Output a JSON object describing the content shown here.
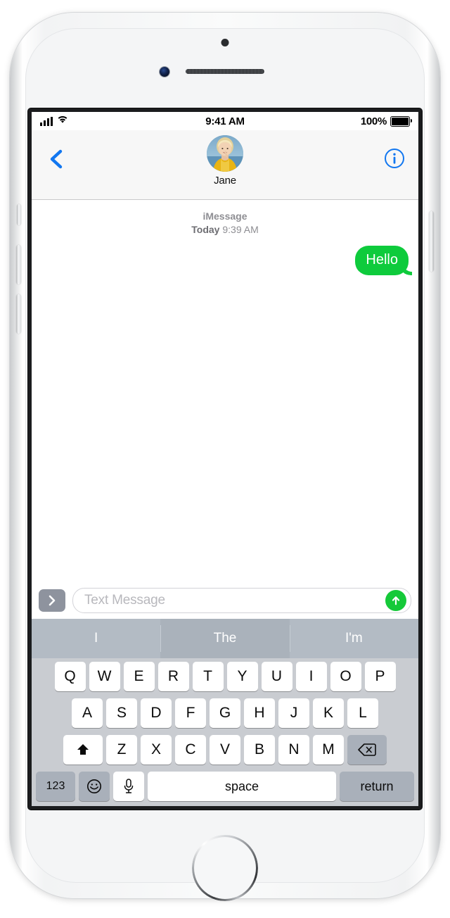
{
  "device": {
    "name": "iPhone",
    "home_button": "home-button",
    "front_camera": "front-camera",
    "earpiece": "earpiece-speaker"
  },
  "status_bar": {
    "signal_icon": "cellular-signal-icon",
    "wifi_icon": "wifi-icon",
    "time": "9:41 AM",
    "battery_percent": "100%",
    "battery_icon": "battery-full-icon"
  },
  "nav_bar": {
    "back_icon": "chevron-left-icon",
    "info_icon": "info-circle-icon",
    "contact_name": "Jane",
    "avatar": "contact-avatar"
  },
  "conversation": {
    "service": "iMessage",
    "day": "Today",
    "time": "9:39 AM",
    "messages": [
      {
        "text": "Hello",
        "direction": "outgoing",
        "style": "green"
      }
    ]
  },
  "input_bar": {
    "app_drawer_icon": "chevron-right-icon",
    "placeholder": "Text Message",
    "value": "",
    "send_icon": "arrow-up-icon"
  },
  "predictive_bar": {
    "suggestions": [
      "I",
      "The",
      "I'm"
    ]
  },
  "keyboard": {
    "row1": [
      "Q",
      "W",
      "E",
      "R",
      "T",
      "Y",
      "U",
      "I",
      "O",
      "P"
    ],
    "row2": [
      "A",
      "S",
      "D",
      "F",
      "G",
      "H",
      "J",
      "K",
      "L"
    ],
    "row3": [
      "Z",
      "X",
      "C",
      "V",
      "B",
      "N",
      "M"
    ],
    "shift_icon": "shift-arrow-icon",
    "delete_icon": "backspace-icon",
    "numbers_key": "123",
    "emoji_icon": "smiley-face-icon",
    "dictation_icon": "microphone-icon",
    "space_key": "space",
    "return_key": "return"
  },
  "colors": {
    "bubble_green": "#0ECB3C",
    "send_green": "#15C939",
    "ios_blue": "#1277F0",
    "keyboard_bg": "#c9ccd1",
    "predictive_bg": "#b3bbc4",
    "nav_bg": "#f7f7f7"
  }
}
